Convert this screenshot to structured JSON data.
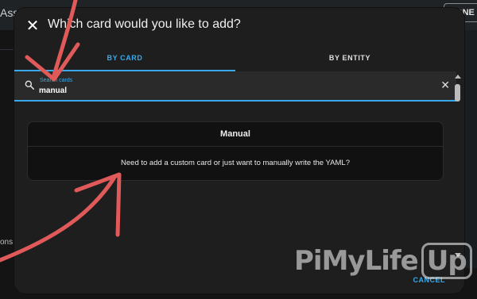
{
  "background": {
    "title_fragment": "Assi",
    "done_label": "DONE",
    "bottom_fragment": "ons"
  },
  "dialog": {
    "title": "Which card would you like to add?",
    "close_icon": "close-icon"
  },
  "tabs": [
    {
      "label": "BY CARD",
      "active": true
    },
    {
      "label": "BY ENTITY",
      "active": false
    }
  ],
  "search": {
    "label": "Search cards",
    "value": "manual",
    "search_icon": "search-icon",
    "clear_icon": "clear-icon"
  },
  "card": {
    "title": "Manual",
    "description": "Need to add a custom card or just want to manually write the YAML?"
  },
  "footer": {
    "cancel_label": "CANCEL"
  },
  "colors": {
    "accent": "#39a9ea",
    "dialog_bg": "#1e1e1e",
    "annotation_arrow": "#e05a5a"
  },
  "watermark": {
    "text": "PiMyLife",
    "badge": "Up"
  }
}
